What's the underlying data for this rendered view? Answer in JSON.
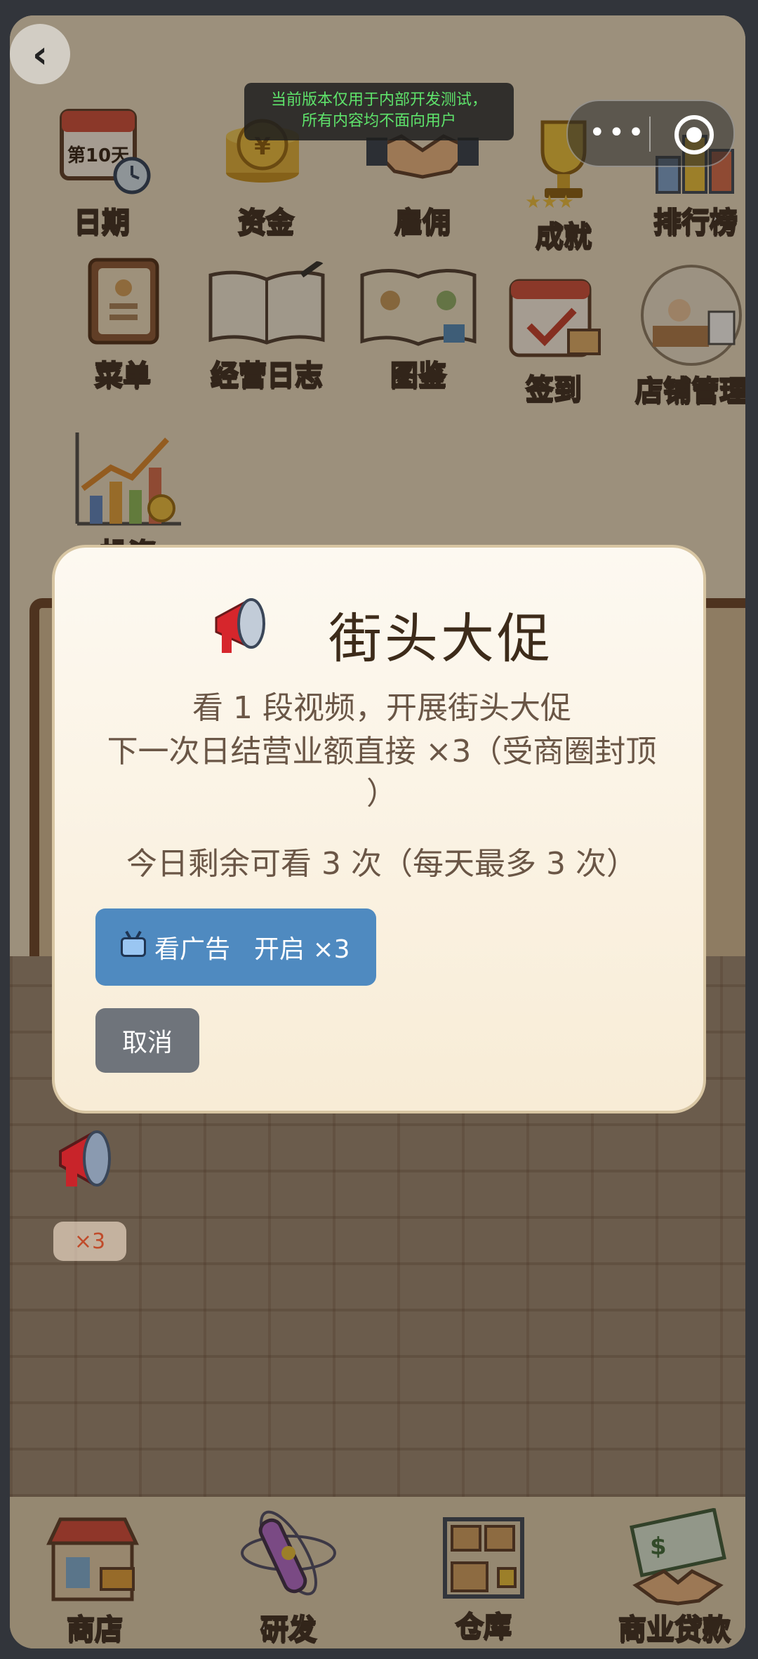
{
  "dev_banner": {
    "line1": "当前版本仅用于内部开发测试，",
    "line2": "所有内容均不面向用户"
  },
  "calendar_day": "第10天",
  "menu_row1": [
    {
      "label": "日期",
      "icon": "calendar-icon"
    },
    {
      "label": "资金",
      "icon": "coins-icon"
    },
    {
      "label": "雇佣",
      "icon": "handshake-icon"
    },
    {
      "label": "成就",
      "icon": "trophy-icon"
    },
    {
      "label": "排行榜",
      "icon": "leaderboard-icon"
    }
  ],
  "menu_row2": [
    {
      "label": "菜单",
      "icon": "menu-book-icon"
    },
    {
      "label": "经营日志",
      "icon": "journal-icon"
    },
    {
      "label": "图鉴",
      "icon": "catalog-icon"
    },
    {
      "label": "签到",
      "icon": "checkin-icon"
    },
    {
      "label": "店铺管理",
      "icon": "shop-manage-icon"
    }
  ],
  "menu_row3": [
    {
      "label": "投资",
      "icon": "investment-chart-icon"
    }
  ],
  "modal": {
    "title": "街头大促",
    "desc_line1": "看 1 段视频，开展街头大促",
    "desc_line2": "下一次日结营业额直接 ×3（受商圈封顶",
    "desc_line3": "）",
    "remaining": "今日剩余可看 3 次（每天最多 3 次）",
    "ad_label": "看广告",
    "ad_action": "开启 ×3",
    "cancel_label": "取消"
  },
  "promo": {
    "badge": "×3"
  },
  "bottom_nav": [
    {
      "label": "商店",
      "icon": "shop-icon"
    },
    {
      "label": "研发",
      "icon": "research-icon"
    },
    {
      "label": "仓库",
      "icon": "warehouse-icon"
    },
    {
      "label": "商业贷款",
      "icon": "loan-icon"
    }
  ],
  "colors": {
    "accent_blue": "#4f8ac0",
    "cancel_gray": "#6f747b",
    "title_brown": "#3d2b1a",
    "dev_green": "#5ee36b"
  }
}
